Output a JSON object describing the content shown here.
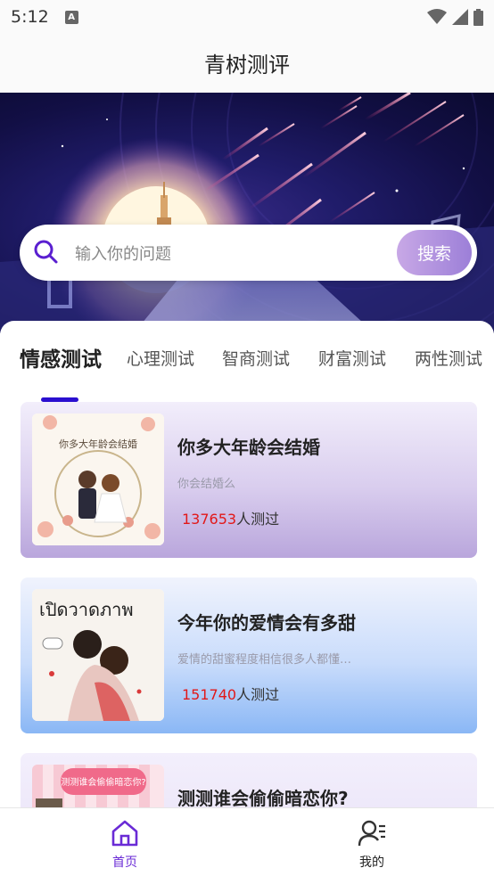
{
  "status_bar": {
    "time": "5:12",
    "icons": [
      "a-notification-icon",
      "wifi-icon",
      "signal-icon",
      "battery-icon"
    ]
  },
  "header": {
    "title": "青树测评"
  },
  "search": {
    "placeholder": "输入你的问题",
    "button_label": "搜索"
  },
  "tabs": [
    {
      "label": "情感测试",
      "active": true
    },
    {
      "label": "心理测试",
      "active": false
    },
    {
      "label": "智商测试",
      "active": false
    },
    {
      "label": "财富测试",
      "active": false
    },
    {
      "label": "两性测试",
      "active": false
    }
  ],
  "cards": [
    {
      "title": "你多大年龄会结婚",
      "desc": "你会结婚么",
      "count": "137653",
      "count_suffix": "人测过",
      "thumb_text": "你多大年龄会结婚"
    },
    {
      "title": "今年你的爱情会有多甜",
      "desc": "爱情的甜蜜程度相信很多人都懂…",
      "count": "151740",
      "count_suffix": "人测过",
      "thumb_text": "เปิดวาดภาพ"
    },
    {
      "title": "测测谁会偷偷暗恋你?",
      "thumb_text": "测测谁会偷偷暗恋你?"
    }
  ],
  "bottom_nav": [
    {
      "label": "首页",
      "icon": "home-icon",
      "active": true
    },
    {
      "label": "我的",
      "icon": "profile-icon",
      "active": false
    }
  ],
  "colors": {
    "accent": "#6a2bd6",
    "tab_indicator": "#2a0fd0",
    "count_number": "#e21818",
    "search_button": "#9c7fd8"
  }
}
